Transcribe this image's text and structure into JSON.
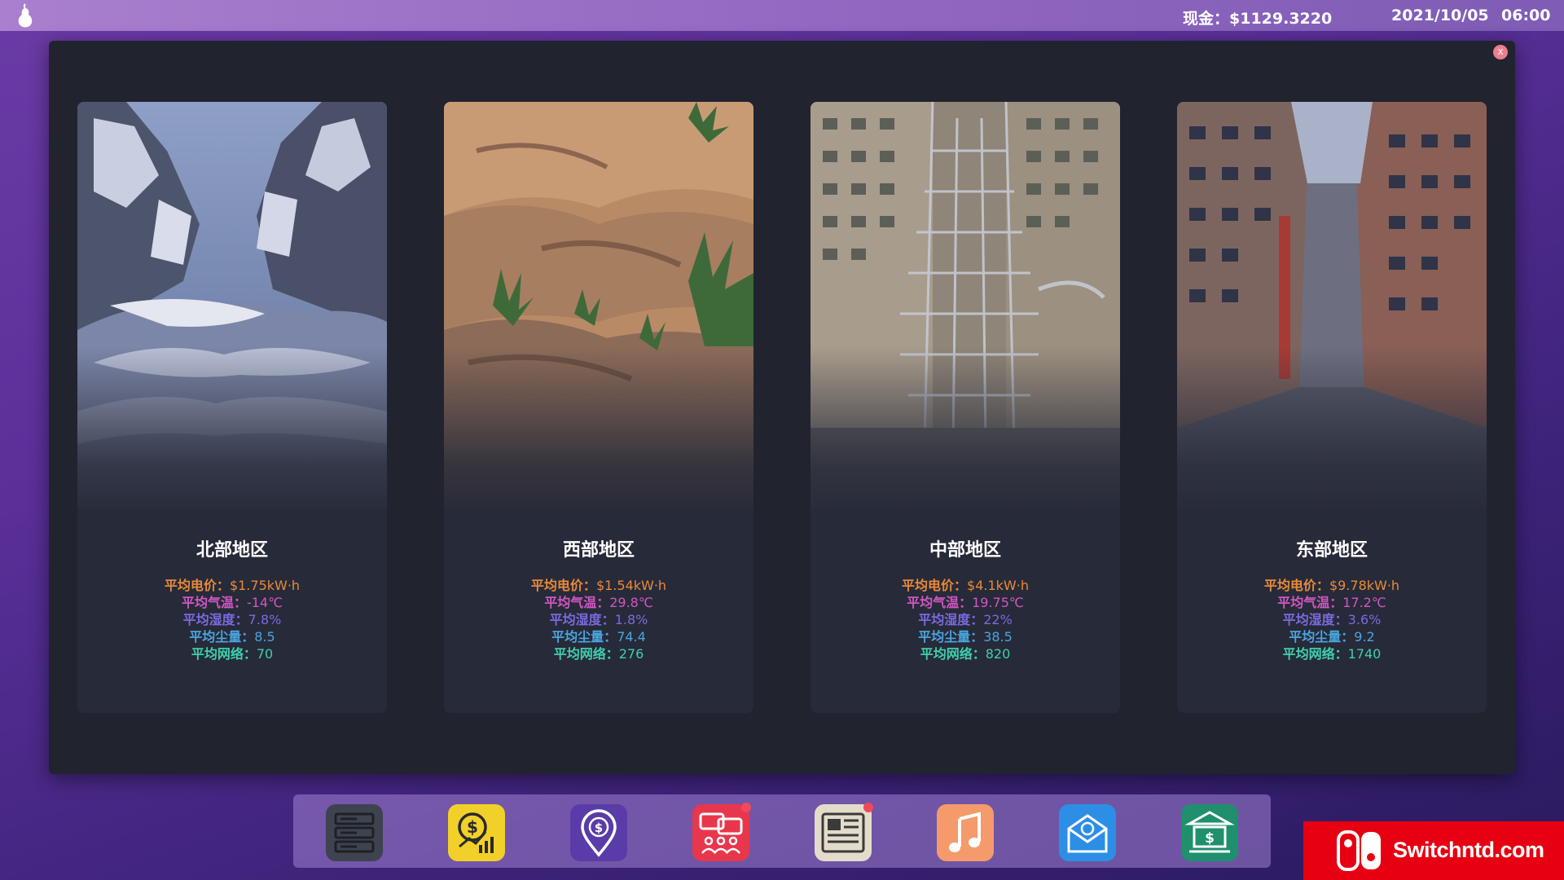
{
  "topbar": {
    "logo_icon": "pear-icon",
    "cash": "现金：$1129.3220",
    "date": "2021/10/05",
    "time": "06:00"
  },
  "modal": {
    "close_label": "x",
    "regions": [
      {
        "name": "北部地区",
        "scene": "snowy-mountain-canyon",
        "price_label": "平均电价：",
        "price": "$1.75kW·h",
        "temp_label": "平均气温：",
        "temp": "-14℃",
        "humidity_label": "平均湿度：",
        "humidity": "7.8%",
        "dust_label": "平均尘量：",
        "dust": "8.5",
        "network_label": "平均网络：",
        "network": "70"
      },
      {
        "name": "西部地区",
        "scene": "desert-dunes-with-plants",
        "price_label": "平均电价：",
        "price": "$1.54kW·h",
        "temp_label": "平均气温：",
        "temp": "29.8℃",
        "humidity_label": "平均湿度：",
        "humidity": "1.8%",
        "dust_label": "平均尘量：",
        "dust": "74.4",
        "network_label": "平均网络：",
        "network": "276"
      },
      {
        "name": "中部地区",
        "scene": "city-buildings-grid",
        "price_label": "平均电价：",
        "price": "$4.1kW·h",
        "temp_label": "平均气温：",
        "temp": "19.75℃",
        "humidity_label": "平均湿度：",
        "humidity": "22%",
        "dust_label": "平均尘量：",
        "dust": "38.5",
        "network_label": "平均网络：",
        "network": "820"
      },
      {
        "name": "东部地区",
        "scene": "dense-city-street",
        "price_label": "平均电价：",
        "price": "$9.78kW·h",
        "temp_label": "平均气温：",
        "temp": "17.2℃",
        "humidity_label": "平均湿度：",
        "humidity": "3.6%",
        "dust_label": "平均尘量：",
        "dust": "9.2",
        "network_label": "平均网络：",
        "network": "1740"
      }
    ]
  },
  "dock": {
    "apps": [
      {
        "icon": "server-rack-icon",
        "color": "#3e4350"
      },
      {
        "icon": "money-chart-icon",
        "color": "#f2d02a"
      },
      {
        "icon": "dollar-pin-icon",
        "color": "#5a3ca8"
      },
      {
        "icon": "chat-people-icon",
        "color": "#e8374c",
        "badge": true
      },
      {
        "icon": "news-icon",
        "color": "#e4dccb",
        "badge": true
      },
      {
        "icon": "music-icon",
        "color": "#f49a6b"
      },
      {
        "icon": "mail-icon",
        "color": "#2d8ee6"
      },
      {
        "icon": "bank-icon",
        "color": "#1f8f6e"
      }
    ]
  },
  "watermark": {
    "text": "Switchntd.com",
    "logo_icon": "nintendo-switch-logo-icon",
    "color": "#e60012"
  }
}
